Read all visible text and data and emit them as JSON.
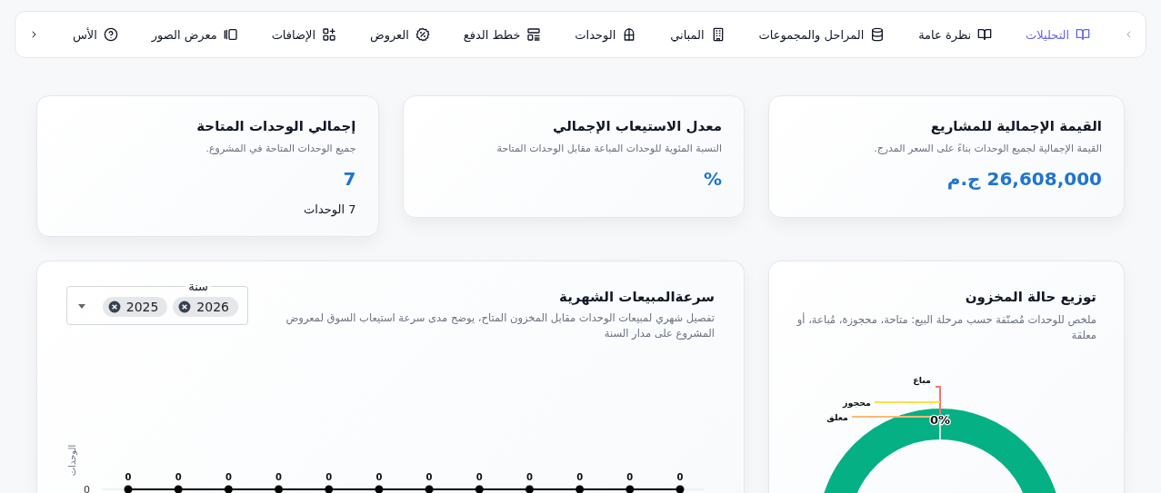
{
  "nav": {
    "items": [
      {
        "label": "التحليلات",
        "selected": true
      },
      {
        "label": "نظرة عامة",
        "selected": false
      },
      {
        "label": "المراحل والمجموعات",
        "selected": false
      },
      {
        "label": "المباني",
        "selected": false
      },
      {
        "label": "الوحدات",
        "selected": false
      },
      {
        "label": "خطط الدفع",
        "selected": false
      },
      {
        "label": "العروض",
        "selected": false
      },
      {
        "label": "الإضافات",
        "selected": false
      },
      {
        "label": "معرض الصور",
        "selected": false
      },
      {
        "label": "الأس",
        "selected": false
      }
    ]
  },
  "stats": [
    {
      "title": "القيمة الإجمالية للمشاريع",
      "subtitle": "القيمة الإجمالية لجميع الوحدات بناءً على السعر المدرج.",
      "value": "26,608,000 ج.م"
    },
    {
      "title": "معدل الاستيعاب الإجمالي",
      "subtitle": "النسبة المئوية للوحدات المباعة مقابل الوحدات المتاحة",
      "value": "%"
    },
    {
      "title": "إجمالي الوحدات المتاحة",
      "subtitle": "جميع الوحدات المتاحة في المشروع.",
      "value": "7",
      "note": "7 الوحدات"
    }
  ],
  "inventory": {
    "title": "توزيع حالة المخزون",
    "subtitle": "ملخص للوحدات مُصنّفة حسب مرحلة البيع: متاحة، محجوزة، مُباعة، أو معلقة",
    "slices": [
      {
        "label": "مباع",
        "color": "#f87171"
      },
      {
        "label": "محجوز",
        "color": "#fde047"
      },
      {
        "label": "معلق",
        "color": "#fdba74"
      }
    ],
    "center_label": "0%"
  },
  "sales": {
    "title": "سرعةالمبيعات الشهرية",
    "subtitle": "تفصيل شهري لمبيعات الوحدات مقابل المخزون المتاح، يوضح مدى سرعة استيعاب السوق لمعروض المشروع على مدار السنة",
    "year_filter": {
      "label": "سنة",
      "chips": [
        "2026",
        "2025"
      ]
    },
    "chart": {
      "axis_title": "الوحدات",
      "y_tick": "0",
      "point_labels": [
        "0",
        "0",
        "0",
        "0",
        "0",
        "0",
        "0",
        "0",
        "0",
        "0",
        "0",
        "0"
      ]
    }
  }
}
